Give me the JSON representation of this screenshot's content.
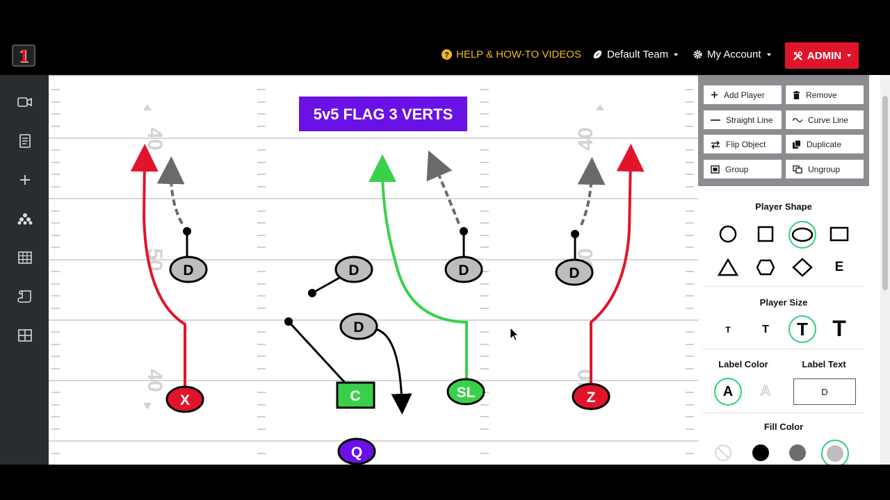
{
  "app": {
    "logo_text": "1"
  },
  "nav": {
    "help": "HELP & HOW-TO VIDEOS",
    "team": "Default Team",
    "account": "My Account",
    "admin": "ADMIN"
  },
  "sidebar": {
    "items": [
      "video-icon",
      "playbook-icon",
      "add-icon",
      "formation-icon",
      "grid-icon",
      "scroll-icon",
      "table-icon"
    ]
  },
  "play": {
    "title": "5v5 FLAG 3 VERTS",
    "yard_labels": [
      "40",
      "50",
      "40",
      "40",
      "50",
      "40"
    ],
    "players": {
      "x": "X",
      "c": "C",
      "sl": "SL",
      "z": "Z",
      "q": "Q",
      "d1": "D",
      "d2": "D",
      "d3": "D",
      "d4": "D",
      "d5": "D"
    }
  },
  "tools": {
    "add_player": "Add Player",
    "remove": "Remove",
    "straight_line": "Straight Line",
    "curve_line": "Curve Line",
    "flip_object": "Flip Object",
    "duplicate": "Duplicate",
    "group": "Group",
    "ungroup": "Ungroup"
  },
  "properties": {
    "player_shape_title": "Player Shape",
    "player_size_title": "Player Size",
    "size_glyph": "T",
    "shape_e_label": "E",
    "label_color_title": "Label Color",
    "label_color_glyph": "A",
    "label_text_title": "Label Text",
    "label_text_value": "D",
    "fill_color_title": "Fill Color"
  },
  "colors": {
    "admin": "#e0152b",
    "help": "#f4b825",
    "title_bg": "#6a11e6",
    "red_route": "#e0152b",
    "green_route": "#3ad14a",
    "selected": "#2fd07e"
  }
}
